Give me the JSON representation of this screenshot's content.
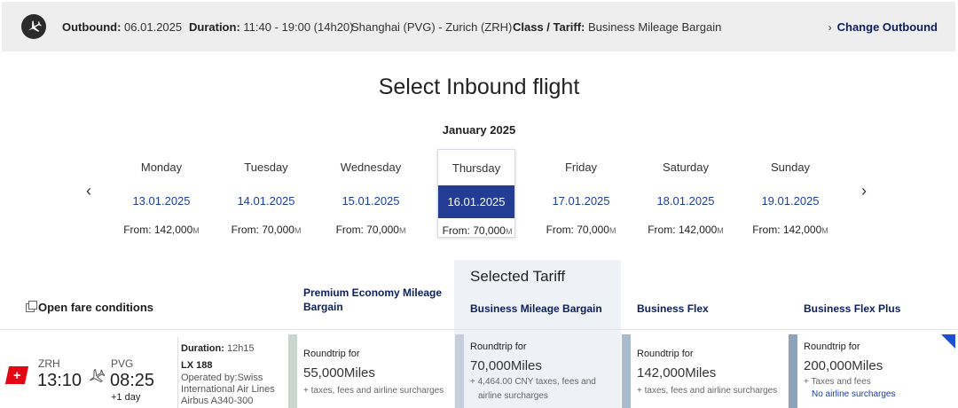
{
  "outbound_bar": {
    "outbound_label": "Outbound:",
    "outbound_date": "06.01.2025",
    "duration_label": "Duration:",
    "duration_value": "11:40 - 19:00 (14h20)",
    "route": "Shanghai (PVG) - Zurich (ZRH)",
    "class_label": "Class / Tariff:",
    "class_value": "Business Mileage Bargain",
    "change_label": "Change Outbound"
  },
  "title": "Select Inbound flight",
  "month": "January 2025",
  "days": [
    {
      "name": "Monday",
      "date": "13.01.2025",
      "from": "From: 142,000"
    },
    {
      "name": "Tuesday",
      "date": "14.01.2025",
      "from": "From: 70,000"
    },
    {
      "name": "Wednesday",
      "date": "15.01.2025",
      "from": "From: 70,000"
    },
    {
      "name": "Thursday",
      "date": "16.01.2025",
      "from": "From: 70,000",
      "selected": true
    },
    {
      "name": "Friday",
      "date": "17.01.2025",
      "from": "From: 70,000"
    },
    {
      "name": "Saturday",
      "date": "18.01.2025",
      "from": "From: 142,000"
    },
    {
      "name": "Sunday",
      "date": "19.01.2025",
      "from": "From: 142,000"
    }
  ],
  "miles_symbol": "M",
  "fare_conditions": "Open fare conditions",
  "selected_tariff_label": "Selected Tariff",
  "tariffs": {
    "premium": "Premium Economy Mileage Bargain",
    "business_bargain": "Business Mileage Bargain",
    "business_flex": "Business Flex",
    "business_flex_plus": "Business Flex Plus"
  },
  "flight": {
    "dep_airport": "ZRH",
    "dep_time": "13:10",
    "arr_airport": "PVG",
    "arr_time": "08:25",
    "plus_day": "+1 day",
    "duration": "Duration:",
    "duration_value": "12h15",
    "flight_no": "LX 188",
    "operated_1": "Operated by:Swiss",
    "operated_2": "International Air Lines",
    "aircraft": "Airbus A340-300"
  },
  "prices": {
    "premium": {
      "rt": "Roundtrip for",
      "miles": "55,000Miles",
      "tax": "+ taxes, fees and airline surcharges"
    },
    "business_bargain": {
      "rt": "Roundtrip for",
      "miles": "70,000Miles",
      "tax1": "+ 4,464.00 CNY taxes, fees and",
      "tax2": "airline surcharges"
    },
    "business_flex": {
      "rt": "Roundtrip for",
      "miles": "142,000Miles",
      "tax": "+ taxes, fees and airline surcharges"
    },
    "business_flex_plus": {
      "rt": "Roundtrip for",
      "miles": "200,000Miles",
      "tax": "+ Taxes and fees",
      "no_surcharge": "No airline surcharges"
    }
  },
  "colors": {
    "accent_blue": "#223d93",
    "link_blue": "#1a3fa3",
    "swiss_red": "#e30613",
    "premium_bar": "#c9d6cf",
    "bargain_bar": "#c6cfdb",
    "flex_bar": "#a9bccd",
    "flex_plus_bar": "#8ea3b7"
  }
}
